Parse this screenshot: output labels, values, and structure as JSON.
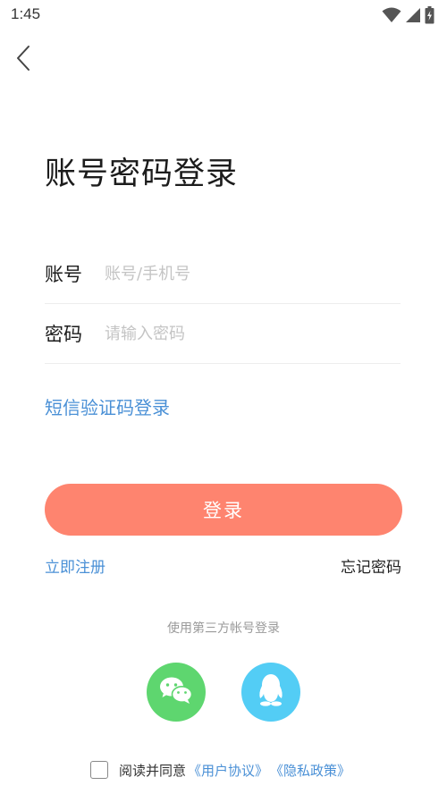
{
  "status_bar": {
    "time": "1:45",
    "icons": [
      "wifi-icon",
      "cellular-signal-icon",
      "battery-icon"
    ]
  },
  "header": {
    "back_icon": "chevron-left-icon"
  },
  "title": "账号密码登录",
  "form": {
    "account": {
      "label": "账号",
      "placeholder": "账号/手机号",
      "value": ""
    },
    "password": {
      "label": "密码",
      "placeholder": "请输入密码",
      "value": ""
    }
  },
  "sms_login_label": "短信验证码登录",
  "login_button_label": "登录",
  "register_label": "立即注册",
  "forgot_password_label": "忘记密码",
  "third_party": {
    "label": "使用第三方帐号登录",
    "providers": [
      {
        "name": "wechat",
        "icon": "wechat-icon",
        "color": "#5ed66f"
      },
      {
        "name": "qq",
        "icon": "qq-penguin-icon",
        "color": "#53cdf5"
      }
    ]
  },
  "agreement": {
    "checked": false,
    "text": "阅读并同意",
    "user_agreement": "《用户协议》",
    "privacy_policy": "《隐私政策》"
  },
  "colors": {
    "accent": "#4a90d6",
    "primary_button": "#fe846f",
    "wechat": "#5ed66f",
    "qq": "#53cdf5"
  }
}
